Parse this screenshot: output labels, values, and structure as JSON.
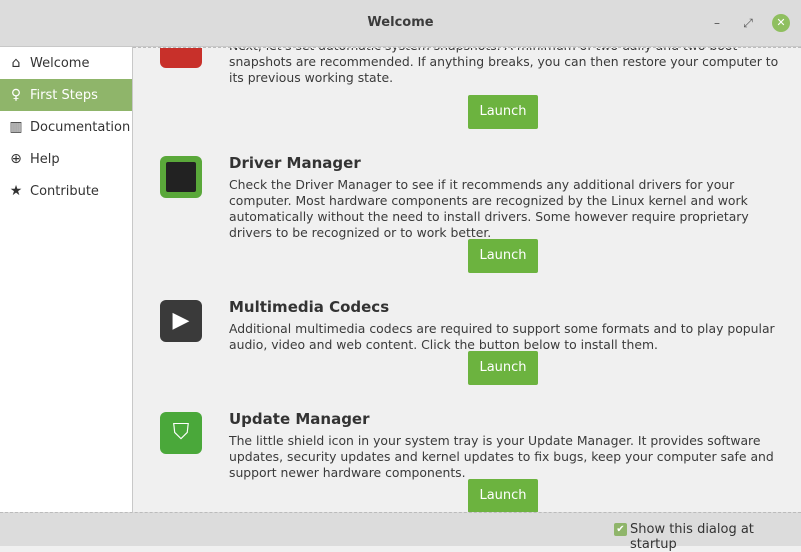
{
  "window": {
    "title": "Welcome",
    "minimize": "–",
    "restore": "⤢",
    "close": "✕"
  },
  "sidebar": {
    "items": [
      {
        "label": "Welcome",
        "icon": "home-icon",
        "glyph": "⌂"
      },
      {
        "label": "First Steps",
        "icon": "lightbulb-icon",
        "glyph": "💡"
      },
      {
        "label": "Documentation",
        "icon": "book-icon",
        "glyph": "📖"
      },
      {
        "label": "Help",
        "icon": "lifebuoy-icon",
        "glyph": "⊕"
      },
      {
        "label": "Contribute",
        "icon": "star-icon",
        "glyph": "★"
      }
    ],
    "active": "First Steps"
  },
  "sections": [
    {
      "title": "",
      "desc": "Next, let's set automatic system snapshots. A minimum of two daily and two boot snapshots are recommended. If anything breaks, you can then restore your computer to its previous working state.",
      "button": "Launch"
    },
    {
      "title": "Driver Manager",
      "desc": "Check the Driver Manager to see if it recommends any additional drivers for your computer. Most hardware components are recognized by the Linux kernel and work automatically without the need to install drivers. Some however require proprietary drivers to be recognized or to work better.",
      "button": "Launch"
    },
    {
      "title": "Multimedia Codecs",
      "desc": "Additional multimedia codecs are required to support some formats and to play popular audio, video and web content. Click the button below to install them.",
      "button": "Launch"
    },
    {
      "title": "Update Manager",
      "desc": "The little shield icon in your system tray is your Update Manager. It provides software updates, security updates and kernel updates to fix bugs, keep your computer safe and support newer hardware components.",
      "button": "Launch"
    }
  ],
  "footer": {
    "checkbox_label": "Show this dialog at startup",
    "checked": true
  },
  "colors": {
    "accent": "#8fb56a",
    "button": "#6cb33f"
  }
}
